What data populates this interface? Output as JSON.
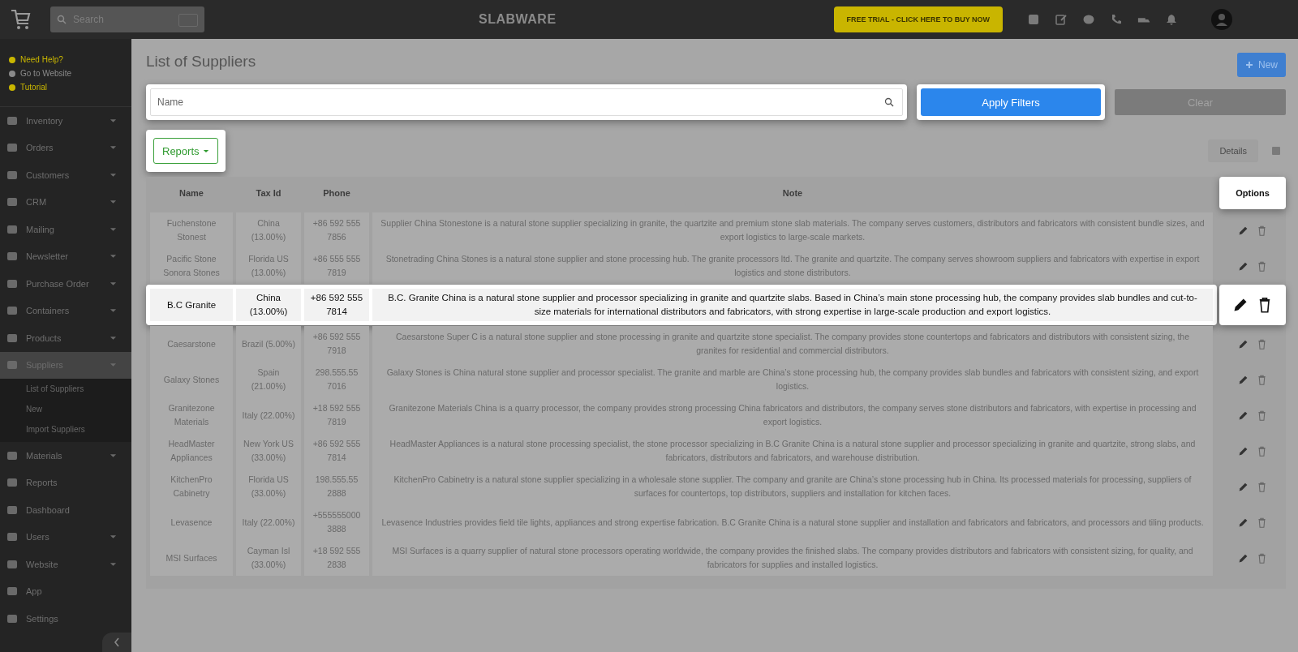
{
  "topbar": {
    "search": {
      "placeholder": "Search"
    },
    "brand": "SLABWARE",
    "trial_button": "FREE TRIAL - CLICK HERE TO BUY NOW"
  },
  "help_links": [
    {
      "label": "Need Help?",
      "color": "#c9b600"
    },
    {
      "label": "Go to Website",
      "color": "#8a8a8a"
    },
    {
      "label": "Tutorial",
      "color": "#c9b600"
    }
  ],
  "sidebar": {
    "items": [
      {
        "label": "Inventory",
        "expandable": true,
        "expanded": false
      },
      {
        "label": "Orders",
        "expandable": true,
        "expanded": false
      },
      {
        "label": "Customers",
        "expandable": true,
        "expanded": false
      },
      {
        "label": "CRM",
        "expandable": true,
        "expanded": false
      },
      {
        "label": "Mailing",
        "expandable": true,
        "expanded": false
      },
      {
        "label": "Newsletter",
        "expandable": true,
        "expanded": false
      },
      {
        "label": "Purchase Order",
        "expandable": true,
        "expanded": false
      },
      {
        "label": "Containers",
        "expandable": true,
        "expanded": false
      },
      {
        "label": "Products",
        "expandable": true,
        "expanded": false
      },
      {
        "label": "Suppliers",
        "expandable": true,
        "expanded": true,
        "children": [
          {
            "label": "List of Suppliers"
          },
          {
            "label": "New"
          },
          {
            "label": "Import Suppliers"
          }
        ]
      },
      {
        "label": "Materials",
        "expandable": true,
        "expanded": false
      },
      {
        "label": "Reports",
        "expandable": false,
        "expanded": false
      },
      {
        "label": "Dashboard",
        "expandable": false,
        "expanded": false
      },
      {
        "label": "Users",
        "expandable": true,
        "expanded": false
      },
      {
        "label": "Website",
        "expandable": true,
        "expanded": false
      },
      {
        "label": "App",
        "expandable": false,
        "expanded": false
      },
      {
        "label": "Settings",
        "expandable": false,
        "expanded": false
      }
    ]
  },
  "page": {
    "title": "List of Suppliers",
    "new_button": "New"
  },
  "filters": {
    "name": {
      "placeholder": "Name",
      "highlighted": true
    },
    "apply_button": {
      "label": "Apply Filters",
      "highlighted": true
    },
    "clear_button": {
      "label": "Clear",
      "highlighted": false
    }
  },
  "reports_button": {
    "label": "Reports",
    "highlighted": true
  },
  "view_menu": "Details",
  "table": {
    "columns": [
      {
        "label": "Name",
        "highlighted": false
      },
      {
        "label": "Tax Id",
        "highlighted": false
      },
      {
        "label": "Phone",
        "highlighted": false
      },
      {
        "label": "Note",
        "highlighted": false
      },
      {
        "label": "Options",
        "highlighted": true
      }
    ],
    "rows": [
      {
        "name": "Fuchenstone Stonest",
        "tax_id": "China (13.00%)",
        "phone": "+86 592 555 7856",
        "note": "Supplier China Stonestone is a natural stone supplier specializing in granite, the quartzite and premium stone slab materials. The company serves customers, distributors and fabricators with consistent bundle sizes, and export logistics to large-scale markets.",
        "highlighted": false
      },
      {
        "name": "Pacific Stone Sonora Stones",
        "tax_id": "Florida US (13.00%)",
        "phone": "+86 555 555 7819",
        "note": "Stonetrading China Stones is a natural stone supplier and stone processing hub. The granite processors ltd. The granite and quartzite. The company serves showroom suppliers and fabricators with expertise in export logistics and stone distributors.",
        "highlighted": false
      },
      {
        "name": "B.C Granite",
        "tax_id": "China (13.00%)",
        "phone": "+86 592 555 7814",
        "note": "B.C. Granite China is a natural stone supplier and processor specializing in granite and quartzite slabs. Based in China’s main stone processing hub, the company provides slab bundles and cut-to-size materials for international distributors and fabricators, with strong expertise in large-scale production and export logistics.",
        "highlighted": true
      },
      {
        "name": "Caesarstone",
        "tax_id": "Brazil (5.00%)",
        "phone": "+86 592 555 7918",
        "note": "Caesarstone Super C is a natural stone supplier and stone processing in granite and quartzite stone specialist. The company provides stone countertops and fabricators and distributors with consistent sizing, the granites for residential and commercial distributors.",
        "highlighted": false
      },
      {
        "name": "Galaxy Stones",
        "tax_id": "Spain (21.00%)",
        "phone": "298.555.55 7016",
        "note": "Galaxy Stones is China natural stone supplier and processor specialist. The granite and marble are China’s stone processing hub, the company provides slab bundles and fabricators with consistent sizing, and export logistics.",
        "highlighted": false
      },
      {
        "name": "Granitezone Materials",
        "tax_id": "Italy (22.00%)",
        "phone": "+18 592 555 7819",
        "note": "Granitezone Materials China is a quarry processor, the company provides strong processing China fabricators and distributors, the company serves stone distributors and fabricators, with expertise in processing and export logistics.",
        "highlighted": false
      },
      {
        "name": "HeadMaster Appliances",
        "tax_id": "New York US (33.00%)",
        "phone": "+86 592 555 7814",
        "note": "HeadMaster Appliances is a natural stone processing specialist, the stone processor specializing in B.C Granite China is a natural stone supplier and processor specializing in granite and quartzite, strong slabs, and fabricators, distributors and fabricators, and warehouse distribution.",
        "highlighted": false
      },
      {
        "name": "KitchenPro Cabinetry",
        "tax_id": "Florida US (33.00%)",
        "phone": "198.555.55 2888",
        "note": "KitchenPro Cabinetry is a natural stone supplier specializing in a wholesale stone supplier. The company and granite are China’s stone processing hub in China. Its processed materials for processing, suppliers of surfaces for countertops, top distributors, suppliers and installation for kitchen faces.",
        "highlighted": false
      },
      {
        "name": "Levasence",
        "tax_id": "Italy (22.00%)",
        "phone": "+555555000 3888",
        "note": "Levasence Industries provides field tile lights, appliances and strong expertise fabrication. B.C Granite China is a natural stone supplier and installation and fabricators and fabricators, and processors and tiling products.",
        "highlighted": false
      },
      {
        "name": "MSI Surfaces",
        "tax_id": "Cayman Isl (33.00%)",
        "phone": "+18 592 555 2838",
        "note": "MSI Surfaces is a quarry supplier of natural stone processors operating worldwide, the company provides the finished slabs. The company provides distributors and fabricators with consistent sizing, for quality, and fabricators for supplies and installed logistics.",
        "highlighted": false
      }
    ]
  }
}
